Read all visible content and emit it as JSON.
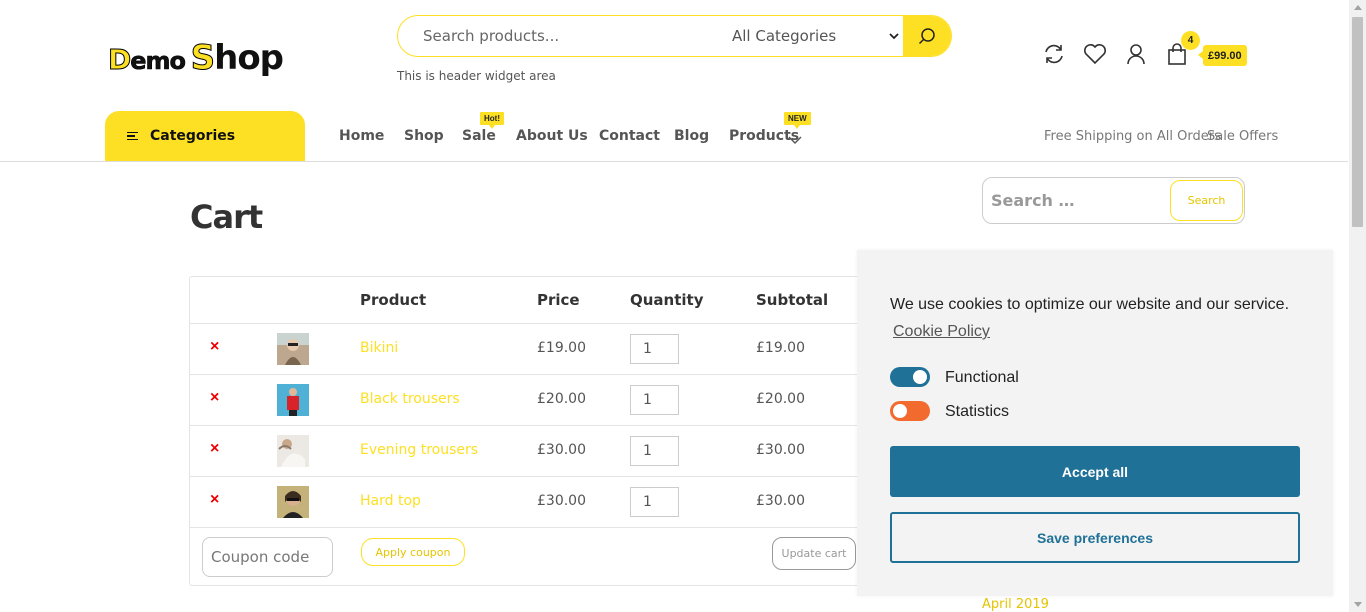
{
  "header": {
    "logo_demo": "Demo",
    "logo_shop": "Shop",
    "search_placeholder": "Search products...",
    "category_select": "All Categories",
    "widget_text": "This is header widget area",
    "cart_count": "4",
    "cart_total": "£99.00"
  },
  "nav": {
    "categories_label": "Categories",
    "items": [
      {
        "label": "Home"
      },
      {
        "label": "Shop"
      },
      {
        "label": "Sale",
        "badge": "Hot!"
      },
      {
        "label": "About Us"
      },
      {
        "label": "Contact"
      },
      {
        "label": "Blog"
      },
      {
        "label": "Products",
        "badge": "NEW"
      }
    ],
    "right_items": [
      "Free Shipping on All Orders",
      "Sale Offers"
    ]
  },
  "page": {
    "title": "Cart"
  },
  "sidebar": {
    "search_placeholder": "Search …",
    "search_button": "Search",
    "archive_link": "April 2019"
  },
  "cart": {
    "columns": [
      "Product",
      "Price",
      "Quantity",
      "Subtotal"
    ],
    "rows": [
      {
        "product": "Bikini",
        "price": "£19.00",
        "qty": "1",
        "subtotal": "£19.00"
      },
      {
        "product": "Black trousers",
        "price": "£20.00",
        "qty": "1",
        "subtotal": "£20.00"
      },
      {
        "product": "Evening trousers",
        "price": "£30.00",
        "qty": "1",
        "subtotal": "£30.00"
      },
      {
        "product": "Hard top",
        "price": "£30.00",
        "qty": "1",
        "subtotal": "£30.00"
      }
    ],
    "remove_symbol": "×",
    "coupon_placeholder": "Coupon code",
    "apply_label": "Apply coupon",
    "update_label": "Update cart"
  },
  "cookie": {
    "message": "We use cookies to optimize our website and our service.",
    "policy_link": "Cookie Policy",
    "functional_label": "Functional",
    "statistics_label": "Statistics",
    "accept_label": "Accept all",
    "save_label": "Save preferences"
  },
  "colors": {
    "accent": "#fde024",
    "cookie_primary": "#1f7197",
    "statistics_toggle": "#f26a2e",
    "remove": "#ee0000"
  }
}
